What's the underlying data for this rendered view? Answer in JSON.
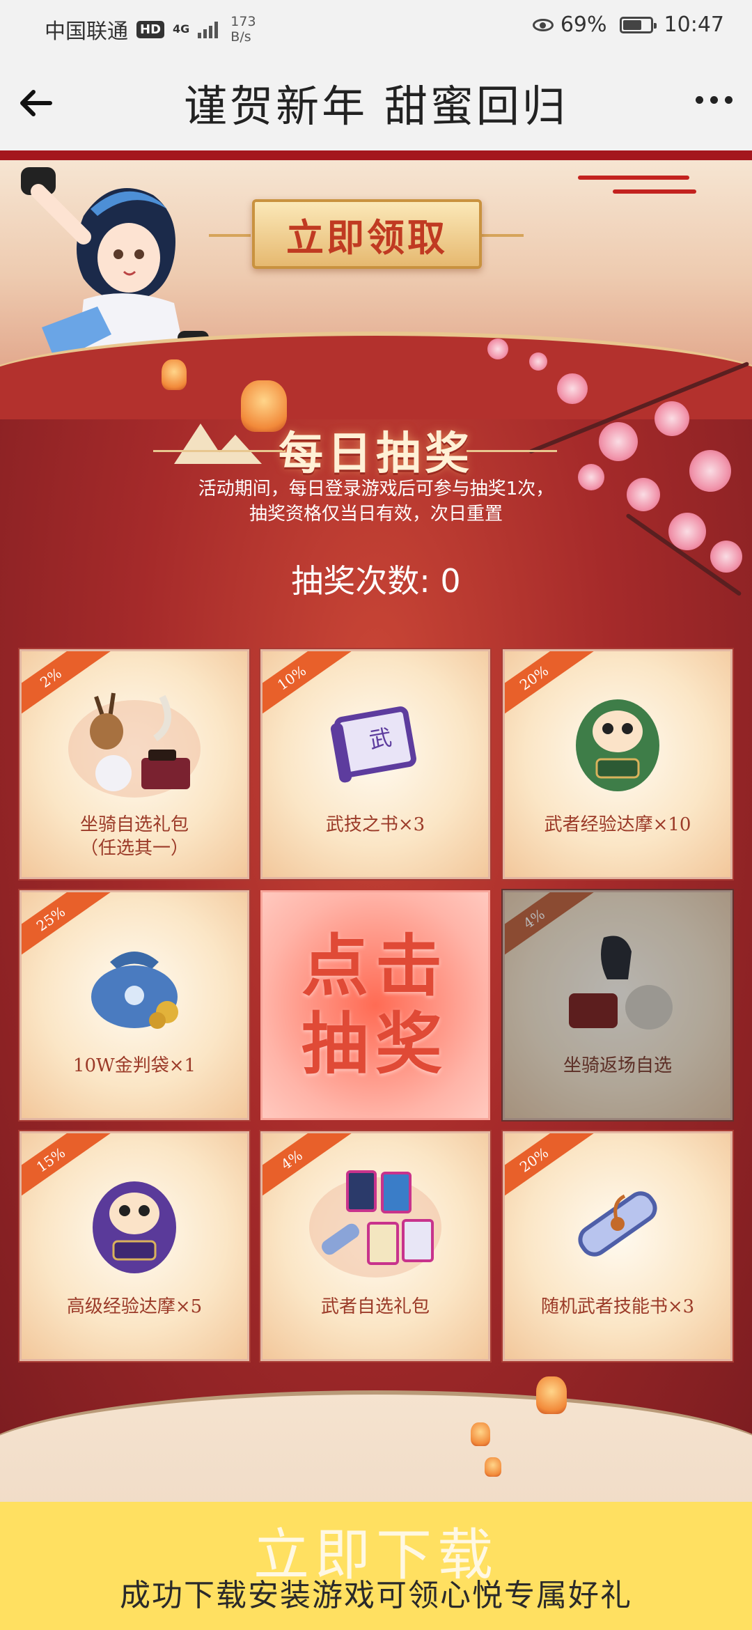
{
  "status_bar": {
    "carrier": "中国联通",
    "hd_badge": "HD",
    "network": "4G",
    "speed_value": "173",
    "speed_unit": "B/s",
    "battery": "69%",
    "battery_level": 0.69,
    "time": "10:47"
  },
  "nav": {
    "back_icon": "arrow-left-icon",
    "title": "谨贺新年  甜蜜回归",
    "more_icon": "more-dots-icon"
  },
  "header": {
    "claim_button": "立即领取"
  },
  "lottery": {
    "title": "每日抽奖",
    "desc_line1": "活动期间，每日登录游戏后可参与抽奖1次，",
    "desc_line2": "抽奖资格仅当日有效，次日重置",
    "draw_count_label": "抽奖次数: 0",
    "draw_button": "点击抽奖",
    "prizes": [
      {
        "rate": "2%",
        "label": "坐骑自选礼包",
        "sublabel": "（任选其一）",
        "icon": "mount-pack-icon"
      },
      {
        "rate": "10%",
        "label": "武技之书×3",
        "sublabel": "",
        "icon": "scroll-book-icon"
      },
      {
        "rate": "20%",
        "label": "武者经验达摩×10",
        "sublabel": "",
        "icon": "green-daruma-icon"
      },
      {
        "rate": "25%",
        "label": "10W金判袋×1",
        "sublabel": "",
        "icon": "gold-bag-icon"
      },
      {
        "rate": "4%",
        "label": "坐骑返场自选",
        "sublabel": "",
        "icon": "mount-return-icon"
      },
      {
        "rate": "15%",
        "label": "高级经验达摩×5",
        "sublabel": "",
        "icon": "purple-daruma-icon"
      },
      {
        "rate": "4%",
        "label": "武者自选礼包",
        "sublabel": "",
        "icon": "warrior-cards-icon"
      },
      {
        "rate": "20%",
        "label": "随机武者技能书×3",
        "sublabel": "",
        "icon": "skill-scroll-icon"
      }
    ]
  },
  "download_banner": {
    "main": "立即下载",
    "sub": "成功下载安装游戏可领心悦专属好礼"
  },
  "colors": {
    "accent_red": "#a4171d",
    "banner_yellow": "#ffe061",
    "ribbon_orange": "#e8602a"
  }
}
